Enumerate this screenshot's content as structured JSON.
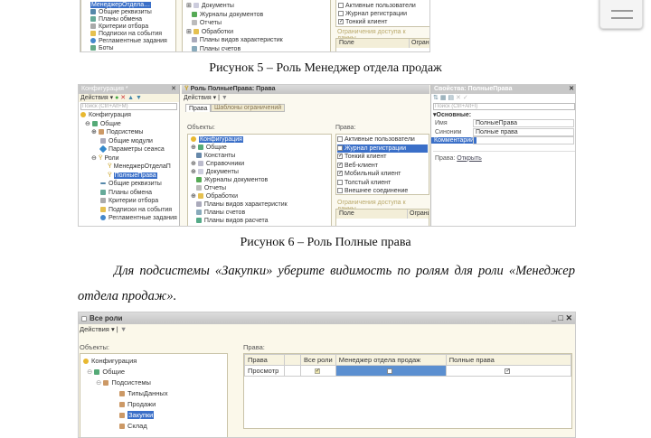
{
  "fig5_fragment": {
    "left_tree": [
      "МенеджерОтдела…",
      "Общие реквизиты",
      "Планы обмена",
      "Критерии отбора",
      "Подписки на события",
      "Регламентные задания",
      "Боты"
    ],
    "mid_tree": [
      "Документы",
      "Журналы документов",
      "Отчеты",
      "Обработки",
      "Планы видов характеристик",
      "Планы счетов"
    ],
    "rights": [
      {
        "label": "Активные пользователи",
        "checked": false
      },
      {
        "label": "Журнал регистрации",
        "checked": false
      },
      {
        "label": "Тонкий клиент",
        "checked": true
      }
    ],
    "restrictions_label": "Ограничения доступа к данны…",
    "col_field": "Поле",
    "col_restr": "Ограни"
  },
  "caption5": "Рисунок 5 – Роль Менеджер отдела продаж",
  "fig6": {
    "config_title": "Конфигурация *",
    "actions": "Действия ▾",
    "search_placeholder": "Поиск (Ctrl+Alt+M)",
    "left_tree": [
      "Конфигурация",
      "Общие",
      "Подсистемы",
      "Общие модули",
      "Параметры сеанса",
      "Роли",
      "МенеджерОтделаП",
      "ПолныеПрава",
      "Общие реквизиты",
      "Планы обмена",
      "Критерии отбора",
      "Подписки на события",
      "Регламентные задания"
    ],
    "role_title": "Роль ПолныеПрава: Права",
    "tabs": [
      "Права",
      "Шаблоны ограничений"
    ],
    "objects_label": "Объекты:",
    "rights_label": "Права:",
    "mid_tree": [
      "Конфигурация",
      "Общие",
      "Константы",
      "Справочники",
      "Документы",
      "Журналы документов",
      "Отчеты",
      "Обработки",
      "Планы видов характеристик",
      "Планы счетов",
      "Планы видов расчета"
    ],
    "rights": [
      {
        "label": "Активные пользователи",
        "checked": false
      },
      {
        "label": "Журнал регистрации",
        "checked": false
      },
      {
        "label": "Тонкий клиент",
        "checked": true
      },
      {
        "label": "Веб-клиент",
        "checked": true
      },
      {
        "label": "Мобильный клиент",
        "checked": true
      },
      {
        "label": "Толстый клиент",
        "checked": false
      },
      {
        "label": "Внешнее соединение",
        "checked": false
      }
    ],
    "restrictions_label": "Ограничения доступа к данны…",
    "col_field": "Поле",
    "col_restr": "Ограни",
    "props_title": "Свойства: ПолныеПрава",
    "props_search": "Поиск (Ctrl+Alt+I)",
    "props_group": "Основные:",
    "props": [
      {
        "name": "Имя",
        "value": "ПолныеПрава"
      },
      {
        "name": "Синоним",
        "value": "Полные права"
      },
      {
        "name": "Комментарий",
        "value": ""
      }
    ],
    "rights_link_label": "Права:",
    "rights_link": "Открыть"
  },
  "caption6": "Рисунок 6 – Роль Полные права",
  "paragraph": "Для подсистемы «Закупки» уберите видимость по ролям для роли «Менеджер отдела продаж».",
  "fig7": {
    "title": "Все роли",
    "actions": "Действия ▾",
    "objects_label": "Объекты:",
    "rights_label": "Права:",
    "tree": [
      "Конфигурация",
      "Общие",
      "Подсистемы",
      "ТипыДанных",
      "Продажи",
      "Закупки",
      "Склад"
    ],
    "columns": [
      "Права",
      "",
      "Все роли",
      "Менеджер отдела продаж",
      "Полные права"
    ],
    "row": {
      "right": "Просмотр",
      "all_roles": true,
      "manager": false,
      "full": true
    }
  }
}
